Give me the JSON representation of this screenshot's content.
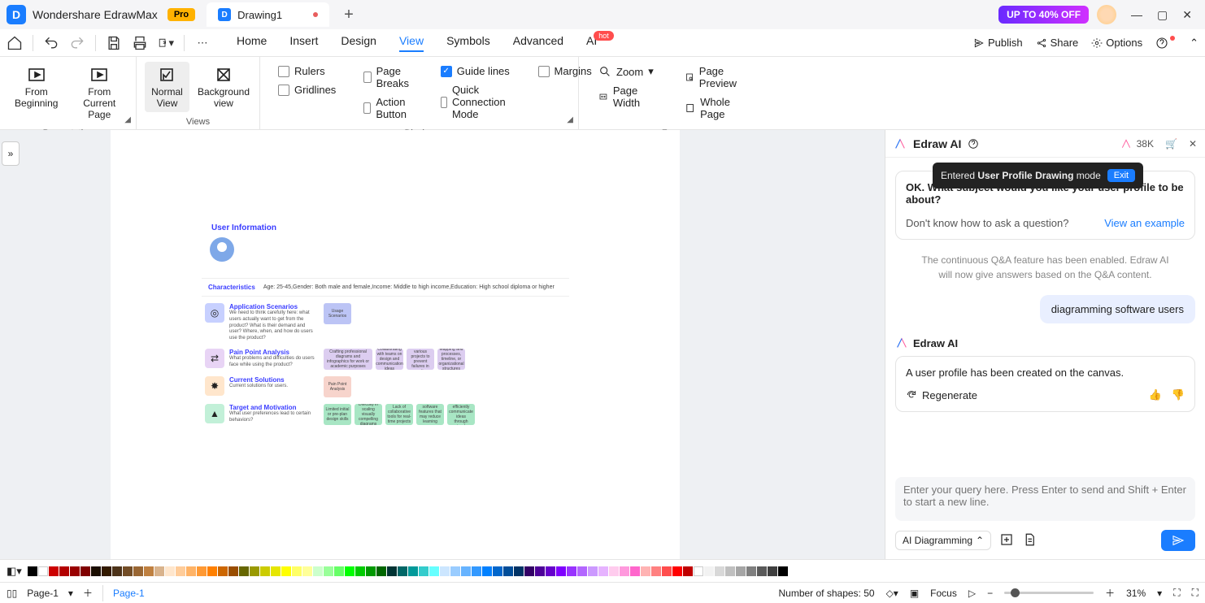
{
  "title": {
    "app": "Wondershare EdrawMax",
    "pro": "Pro",
    "tab": "Drawing1",
    "promo": "UP TO 40% OFF"
  },
  "menu": [
    "Home",
    "Insert",
    "Design",
    "View",
    "Symbols",
    "Advanced",
    "AI"
  ],
  "menu_hot": "hot",
  "toolbar_right": {
    "publish": "Publish",
    "share": "Share",
    "options": "Options"
  },
  "ribbon": {
    "presentation": {
      "b1": "From Beginning",
      "b2": "From Current Page",
      "label": "Presentation"
    },
    "views": {
      "b1": "Normal View",
      "b2": "Background view",
      "label": "Views"
    },
    "display": {
      "rulers": "Rulers",
      "pagebreaks": "Page Breaks",
      "guidelines": "Guide lines",
      "margins": "Margins",
      "gridlines": "Gridlines",
      "actionbtn": "Action Button",
      "quickconn": "Quick Connection Mode",
      "label": "Display"
    },
    "zoom": {
      "zoom": "Zoom",
      "preview": "Page Preview",
      "width": "Page Width",
      "whole": "Whole Page",
      "label": "Zoom"
    }
  },
  "canvas": {
    "userinfo": "User Information",
    "char_label": "Characteristics",
    "char_text": "Age: 25-45,Gender: Both male and female,Income: Middle to high income,Education: High school diploma or higher",
    "s1": {
      "title": "Application Scenarios",
      "desc": "We need to think carefully here: what users actually want to get from the product? What is their demand and user? Where, when, and how do users use the product?",
      "card": "Usage Scenarios"
    },
    "s2": {
      "title": "Pain Point Analysis",
      "desc": "What problems and difficulties do users face while using the product?",
      "c1": "Crafting professional diagrams and infographics for work or academic purposes",
      "c2": "Collaborating with teams on design and communication ideas",
      "c3": "Blooking various projects to prevent failures in practice",
      "c4": "Mapping and processes, timeline, or organizational structures"
    },
    "s3": {
      "title": "Current Solutions",
      "desc": "Current solutions for users.",
      "c1": "Pain Point Analysis"
    },
    "s4": {
      "title": "Target and Motivation",
      "desc": "What user preferences lead to certain behaviors?",
      "c1": "Limited initial or pre-plan design skills",
      "c2": "Difficulty in scaling visually compelling diagrams",
      "c3": "Lack of collaborative tools for real-time projects",
      "c4": "Creation of software features that may reduce learning curves",
      "c5": "Inability to efficiently communicate ideas through visuals"
    }
  },
  "ai": {
    "title": "Edraw AI",
    "tokens": "38K",
    "toast_pre": "Entered ",
    "toast_bold": "User Profile Drawing",
    "toast_post": " mode",
    "exit": "Exit",
    "ok": "OK. What subject would you like your user profile to be about?",
    "help": "Don't know how to ask a question?",
    "view": "View an example",
    "info": "The continuous Q&A feature has been enabled. Edraw AI will now give answers based on the Q&A content.",
    "user_msg": "diagramming software users",
    "bot_name": "Edraw AI",
    "bot_msg": "A user profile has been created on the canvas.",
    "regen": "Regenerate",
    "placeholder": "Enter your query here. Press Enter to send and Shift + Enter to start a new line.",
    "mode": "AI Diagramming"
  },
  "status": {
    "pagename": "Page-1",
    "pagetab": "Page-1",
    "shapes": "Number of shapes: 50",
    "focus": "Focus",
    "zoom": "31%"
  },
  "palette": [
    "#000000",
    "#3f3f3f",
    "#595959",
    "#7f7f7f",
    "#a5a5a5",
    "#bfbfbf",
    "#d8d8d8",
    "#f2f2f2",
    "#ffffff",
    "#c00000",
    "#ff0000",
    "#ff4d4d",
    "#ff8080",
    "#ffb3b3",
    "#ff66cc",
    "#ff99dd",
    "#ffccee",
    "#e6b3ff",
    "#cc99ff",
    "#b366ff",
    "#9933ff",
    "#7f00ff",
    "#6600cc",
    "#4d0099",
    "#330066",
    "#003366",
    "#004d99",
    "#0066cc",
    "#0080ff",
    "#3399ff",
    "#66b3ff",
    "#99ccff",
    "#ccE6ff",
    "#66ffff",
    "#33cccc",
    "#009999",
    "#006666",
    "#003333",
    "#006600",
    "#009900",
    "#00cc00",
    "#00ff00",
    "#66ff66",
    "#99ff99",
    "#ccffcc",
    "#ffff99",
    "#ffff66",
    "#ffff00",
    "#e6e600",
    "#cccc00",
    "#999900",
    "#666600",
    "#994d00",
    "#cc6600",
    "#ff8000",
    "#ff9933",
    "#ffb366",
    "#ffcc99",
    "#ffe6cc",
    "#d9b38c",
    "#bf8040",
    "#996633",
    "#734d26",
    "#4d3319",
    "#331a00",
    "#1a0d00",
    "#800000",
    "#990000",
    "#b30000",
    "#cc0000",
    "#ffffff",
    "#000000"
  ]
}
